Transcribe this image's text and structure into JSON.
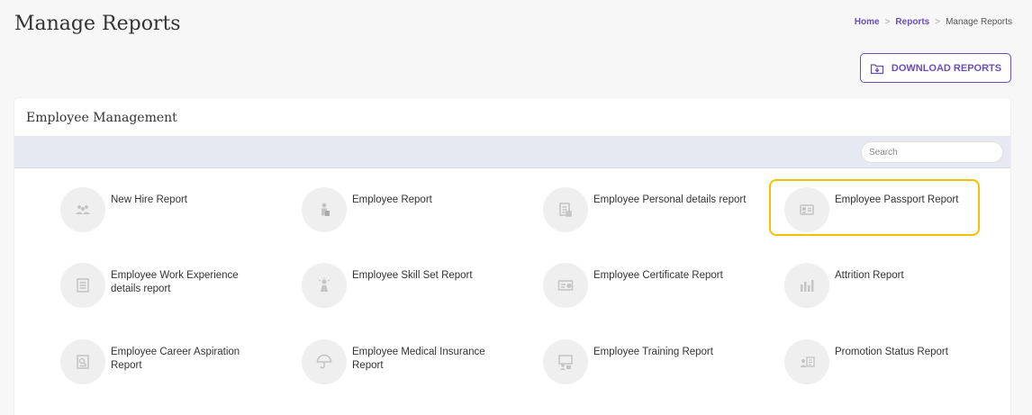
{
  "header": {
    "title": "Manage Reports"
  },
  "breadcrumb": {
    "home": "Home",
    "reports": "Reports",
    "current": "Manage Reports",
    "separator": ">"
  },
  "toolbar": {
    "download_label": "DOWNLOAD REPORTS"
  },
  "card": {
    "title": "Employee Management"
  },
  "search": {
    "placeholder": "Search"
  },
  "colors": {
    "accent": "#6a4fb5",
    "highlight": "#f2c200"
  },
  "reports": [
    {
      "label": "New Hire Report",
      "icon": "people-icon"
    },
    {
      "label": "Employee Report",
      "icon": "employee-icon"
    },
    {
      "label": "Employee Personal details report",
      "icon": "document-icon"
    },
    {
      "label": "Employee Passport Report",
      "icon": "id-card-icon"
    },
    {
      "label": "Employee Work Experience details report",
      "icon": "list-document-icon"
    },
    {
      "label": "Employee Skill Set Report",
      "icon": "skill-icon"
    },
    {
      "label": "Employee Certificate Report",
      "icon": "certificate-icon"
    },
    {
      "label": "Attrition Report",
      "icon": "bar-chart-icon"
    },
    {
      "label": "Employee Career Aspiration Report",
      "icon": "career-icon"
    },
    {
      "label": "Employee Medical Insurance Report",
      "icon": "umbrella-icon"
    },
    {
      "label": "Employee Training Report",
      "icon": "training-icon"
    },
    {
      "label": "Promotion Status Report",
      "icon": "promotion-icon"
    }
  ]
}
